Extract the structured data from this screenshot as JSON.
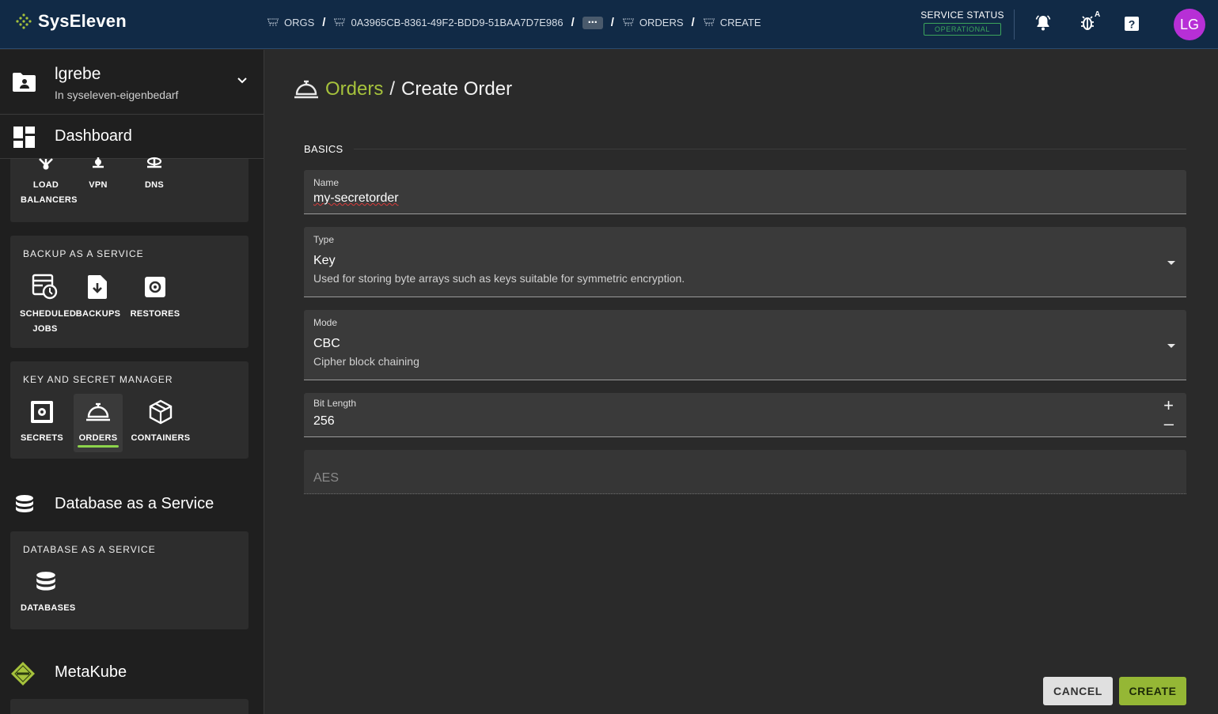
{
  "brand": {
    "name": "SysEleven"
  },
  "breadcrumbs": {
    "orgs": "ORGS",
    "project_id": "0A3965CB-8361-49F2-BDD9-51BAA7D7E986",
    "more": "⋯",
    "orders": "ORDERS",
    "create": "CREATE",
    "separator": "/"
  },
  "service_status": {
    "label": "SERVICE STATUS",
    "value": "OPERATIONAL"
  },
  "user": {
    "initials": "LG"
  },
  "sidebar": {
    "project": {
      "title": "lgrebe",
      "subtitle": "In syseleven-eigenbedarf"
    },
    "dashboard_label": "Dashboard",
    "network_tiles": [
      {
        "label": "LOAD BALANCERS"
      },
      {
        "label": "VPN"
      },
      {
        "label": "DNS"
      }
    ],
    "backup_card": {
      "title": "BACKUP AS A SERVICE",
      "tiles": [
        {
          "label": "SCHEDULED JOBS"
        },
        {
          "label": "BACKUPS"
        },
        {
          "label": "RESTORES"
        }
      ]
    },
    "kms_card": {
      "title": "KEY AND SECRET MANAGER",
      "tiles": [
        {
          "label": "SECRETS"
        },
        {
          "label": "ORDERS"
        },
        {
          "label": "CONTAINERS"
        }
      ]
    },
    "dbaas_section": {
      "label": "Database as a Service"
    },
    "dbaas_card": {
      "title": "DATABASE AS A SERVICE",
      "tiles": [
        {
          "label": "DATABASES"
        }
      ]
    },
    "metakube_section": {
      "label": "MetaKube"
    }
  },
  "main": {
    "title_link": "Orders",
    "title_sep": "/",
    "title_current": "Create Order",
    "basics_label": "BASICS",
    "fields": {
      "name": {
        "label": "Name",
        "value": "my-secretorder"
      },
      "type": {
        "label": "Type",
        "value": "Key",
        "hint": "Used for storing byte arrays such as keys suitable for symmetric encryption."
      },
      "mode": {
        "label": "Mode",
        "value": "CBC",
        "hint": "Cipher block chaining"
      },
      "bit_length": {
        "label": "Bit Length",
        "value": "256",
        "plus": "+",
        "minus": "–"
      },
      "algorithm": {
        "value": "AES"
      }
    },
    "cancel_label": "CANCEL",
    "create_label": "CREATE"
  },
  "colors": {
    "topbar": "#112a46",
    "accent_green": "#95b735",
    "link_green": "#a6c23c",
    "status_green": "#3ca55c",
    "avatar": "#b72fd6"
  },
  "icons": {
    "brand": "syseleven-diamond-icon",
    "bell": "bell-icon",
    "bug": "bug-icon",
    "help": "help-icon",
    "orders": "service-bell-icon"
  }
}
